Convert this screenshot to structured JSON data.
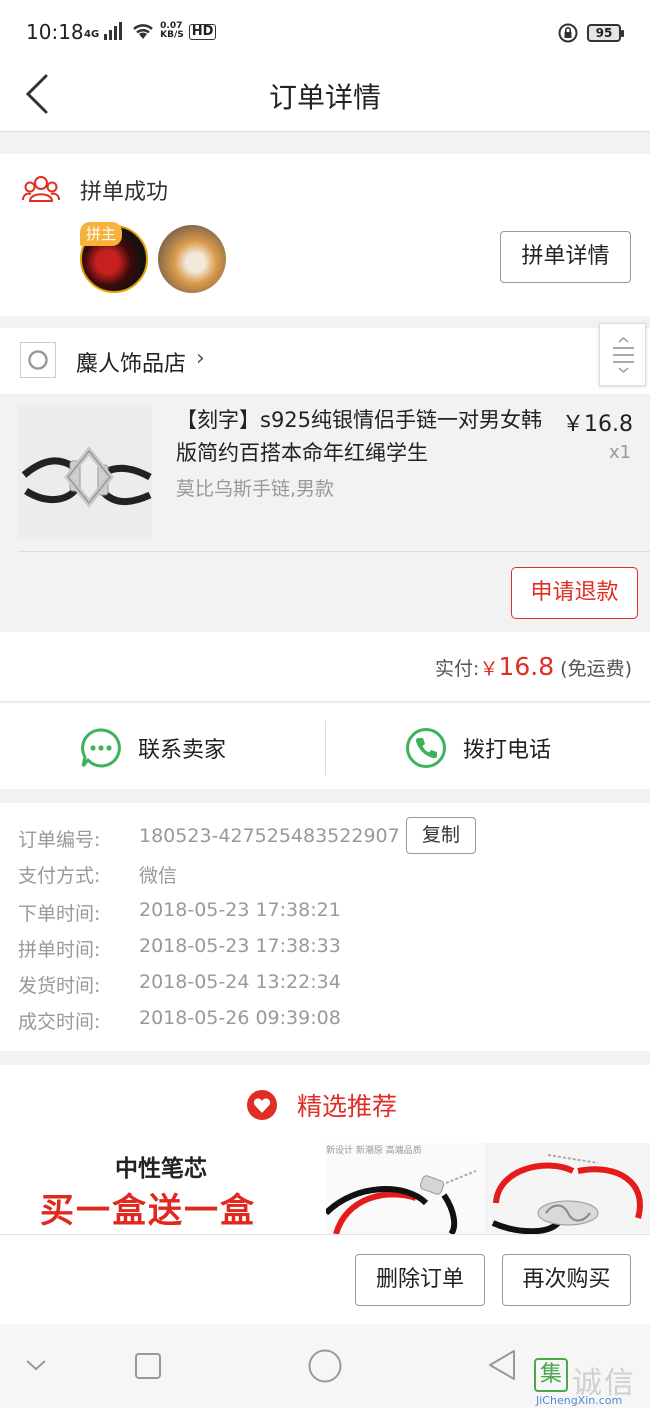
{
  "status_bar": {
    "time": "10:18",
    "network": "4G",
    "speed": "0.07",
    "speed_unit": "KB/S",
    "hd": "HD",
    "battery": "95"
  },
  "nav": {
    "title": "订单详情",
    "back_icon": "chevron-left-icon"
  },
  "group": {
    "status": "拼单成功",
    "host_badge": "拼主",
    "detail_button": "拼单详情"
  },
  "shop": {
    "name": "麋人饰品店",
    "chevron": "›"
  },
  "product": {
    "title": "【刻字】s925纯银情侣手链一对男女韩版简约百搭本命年红绳学生",
    "spec": "莫比乌斯手链,男款",
    "price": "￥16.8",
    "qty": "x1",
    "refund_button": "申请退款"
  },
  "payment": {
    "label": "实付:",
    "currency": "￥",
    "amount": "16.8",
    "note": "(免运费)"
  },
  "contact": {
    "seller": "联系卖家",
    "phone": "拨打电话"
  },
  "order_info": {
    "copy_button": "复制",
    "rows": [
      {
        "label": "订单编号:",
        "value": "180523-427525483522907"
      },
      {
        "label": "支付方式:",
        "value": "微信"
      },
      {
        "label": "下单时间:",
        "value": "2018-05-23 17:38:21"
      },
      {
        "label": "拼单时间:",
        "value": "2018-05-23 17:38:33"
      },
      {
        "label": "发货时间:",
        "value": "2018-05-24 13:22:34"
      },
      {
        "label": "成交时间:",
        "value": "2018-05-26 09:39:08"
      }
    ]
  },
  "recommend": {
    "title": "精选推荐",
    "banner1_line1": "中性笔芯",
    "banner1_line2": "买一盒送一盒",
    "banner2_caption": "新设计 新潮原 高端品质"
  },
  "bottom_actions": {
    "delete": "删除订单",
    "rebuy": "再次购买"
  },
  "watermark": {
    "mark": "集",
    "text": "诚信",
    "url": "JiChengXin.com"
  },
  "colors": {
    "accent_red": "#e02e24",
    "icon_green": "#3cb35a"
  }
}
